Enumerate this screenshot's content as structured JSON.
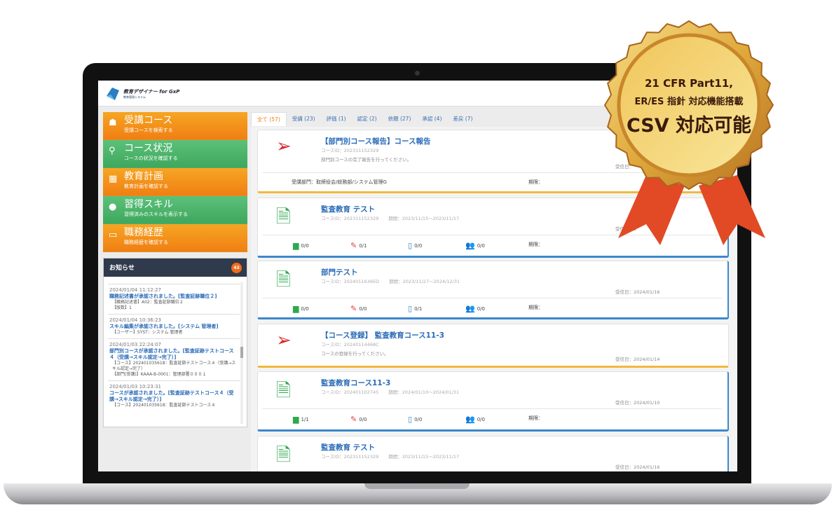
{
  "app": {
    "title": "教育デザイナー for GxP",
    "subtitle": "教育管理システム"
  },
  "menu": [
    {
      "icon": "graduation-cap-icon",
      "title": "受講コース",
      "desc": "受講コースを検索する",
      "color": "orange"
    },
    {
      "icon": "search-icon",
      "title": "コース状況",
      "desc": "コースの状況を確認する",
      "color": "green"
    },
    {
      "icon": "calendar-icon",
      "title": "教育計画",
      "desc": "教育計画を確認する",
      "color": "orange"
    },
    {
      "icon": "award-icon",
      "title": "習得スキル",
      "desc": "習得済みのスキルを表示する",
      "color": "green"
    },
    {
      "icon": "id-card-icon",
      "title": "職務経歴",
      "desc": "職務経歴を確認する",
      "color": "orange"
    }
  ],
  "news": {
    "title": "お知らせ",
    "count": "43",
    "items": [
      {
        "date": "2024/01/04 11:12:27",
        "msg": "職務記述書が承認されました。[監査証跡職位２]",
        "details": [
          "【職務記述書】A02：監査証跡職位２",
          "【版数】1"
        ]
      },
      {
        "date": "2024/01/04 10:36:23",
        "msg": "スキル編集が承認されました。[システム 管理者]",
        "details": [
          "【ユーザー】SYST：システム 管理者"
        ]
      },
      {
        "date": "2024/01/03 22:24:07",
        "msg": "部門別コースが承認されました。[監査証跡テストコース４（受講→スキル認定→完了）]",
        "details": [
          "【コース】202401035618：監査証跡テストコース４（受講→スキル認定→完了）",
          "【部門(受講)】KAAA-B-0001：管理部署０００１"
        ]
      },
      {
        "date": "2024/01/03 10:23:31",
        "msg": "コースが承認されました。[監査証跡テストコース４（受講→スキル認定→完了）]",
        "details": [
          "【コース】202401035618：監査証跡テストコース４"
        ]
      }
    ]
  },
  "tabs": [
    "全て (57)",
    "受講 (23)",
    "評価 (1)",
    "認定 (2)",
    "依頼 (27)",
    "承認 (4)",
    "差戻 (7)"
  ],
  "labels": {
    "deadline": "期限：",
    "received": "受信日："
  },
  "cards": [
    {
      "type": "request",
      "title": "【部門別コース報告】コース報告",
      "course_id": "コースID：202311152329",
      "desc": "部門別コースの完了報告を行ってください。",
      "received": "受信日：",
      "dept": "受講部門：取締役会/総務部/システム管理G"
    },
    {
      "type": "course",
      "title": "監査教育 テスト",
      "course_id": "コースID：202311152329",
      "period": "期間：2023/11/15～2023/11/17",
      "received": "受信日：2",
      "stats": [
        "0/0",
        "0/1",
        "0/0",
        "0/0"
      ]
    },
    {
      "type": "course",
      "title": "部門テスト",
      "course_id": "コースID：2024011636ED",
      "period": "期間：2023/11/27～2024/12/31",
      "received": "受信日：2024/01/16",
      "stats": [
        "0/0",
        "0/0",
        "0/1",
        "0/0"
      ]
    },
    {
      "type": "request",
      "title": "【コース登録】 監査教育コース11-3",
      "course_id": "コースID：20240114468C",
      "desc": "コースの登録を行ってください。",
      "received": "受信日：2024/01/14"
    },
    {
      "type": "course",
      "title": "監査教育コース11-3",
      "course_id": "コースID：202401102745",
      "period": "期間：2024/01/10～2024/01/31",
      "received": "受信日：2024/01/10",
      "stats": [
        "1/1",
        "0/0",
        "0/0",
        "0/0"
      ]
    },
    {
      "type": "course",
      "title": "監査教育 テスト",
      "course_id": "コースID：202311152329",
      "period": "期間：2023/11/15～2023/11/17",
      "received": "受信日：2024/01/16"
    }
  ],
  "medal": {
    "line1": "21 CFR Part11,",
    "line2": "ER/ES 指針 対応機能搭載",
    "line3": "CSV 対応可能"
  },
  "colors": {
    "orange": "#f07f13",
    "green": "#3fa85d",
    "link": "#2a6bb8",
    "request_border": "#f0b93a",
    "course_border": "#3b88cc"
  }
}
